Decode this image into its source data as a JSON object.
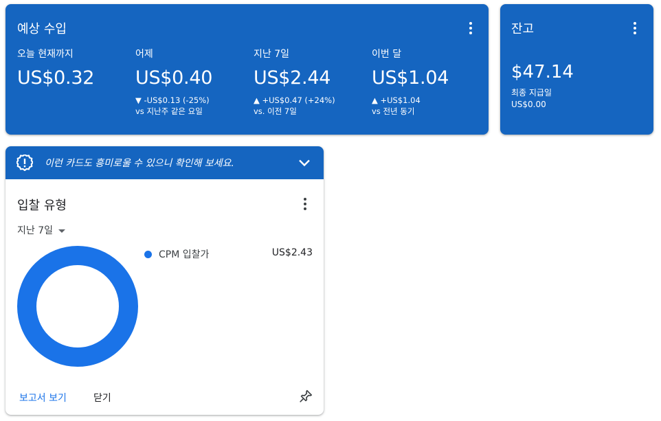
{
  "earnings": {
    "title": "예상 수입",
    "metrics": [
      {
        "label": "오늘 현재까지",
        "value": "US$0.32",
        "change": "",
        "compare": ""
      },
      {
        "label": "어제",
        "value": "US$0.40",
        "change": "▼ -US$0.13 (-25%)",
        "compare": "vs 지난주 같은 요일"
      },
      {
        "label": "지난 7일",
        "value": "US$2.44",
        "change": "▲ +US$0.47 (+24%)",
        "compare": "vs. 이전 7일"
      },
      {
        "label": "이번 달",
        "value": "US$1.04",
        "change": "▲ +US$1.04",
        "compare": "vs 전년 동기"
      }
    ]
  },
  "balance": {
    "title": "잔고",
    "amount": "$47.14",
    "last_payment_label": "최종 지급일",
    "last_payment_value": "US$0.00"
  },
  "suggestion_banner": {
    "text": "이런 카드도 흥미로울 수 있으니 확인해 보세요."
  },
  "bid_type_card": {
    "title": "입찰 유형",
    "date_range": "지난 7일",
    "legend": [
      {
        "name": "CPM 입찰가",
        "value": "US$2.43",
        "color": "#1a73e8"
      }
    ],
    "view_report": "보고서 보기",
    "close": "닫기"
  },
  "chart_data": {
    "type": "pie",
    "categories": [
      "CPM 입찰가"
    ],
    "values": [
      2.43
    ]
  },
  "colors": {
    "card_blue": "#1565c0",
    "accent": "#1a73e8"
  }
}
